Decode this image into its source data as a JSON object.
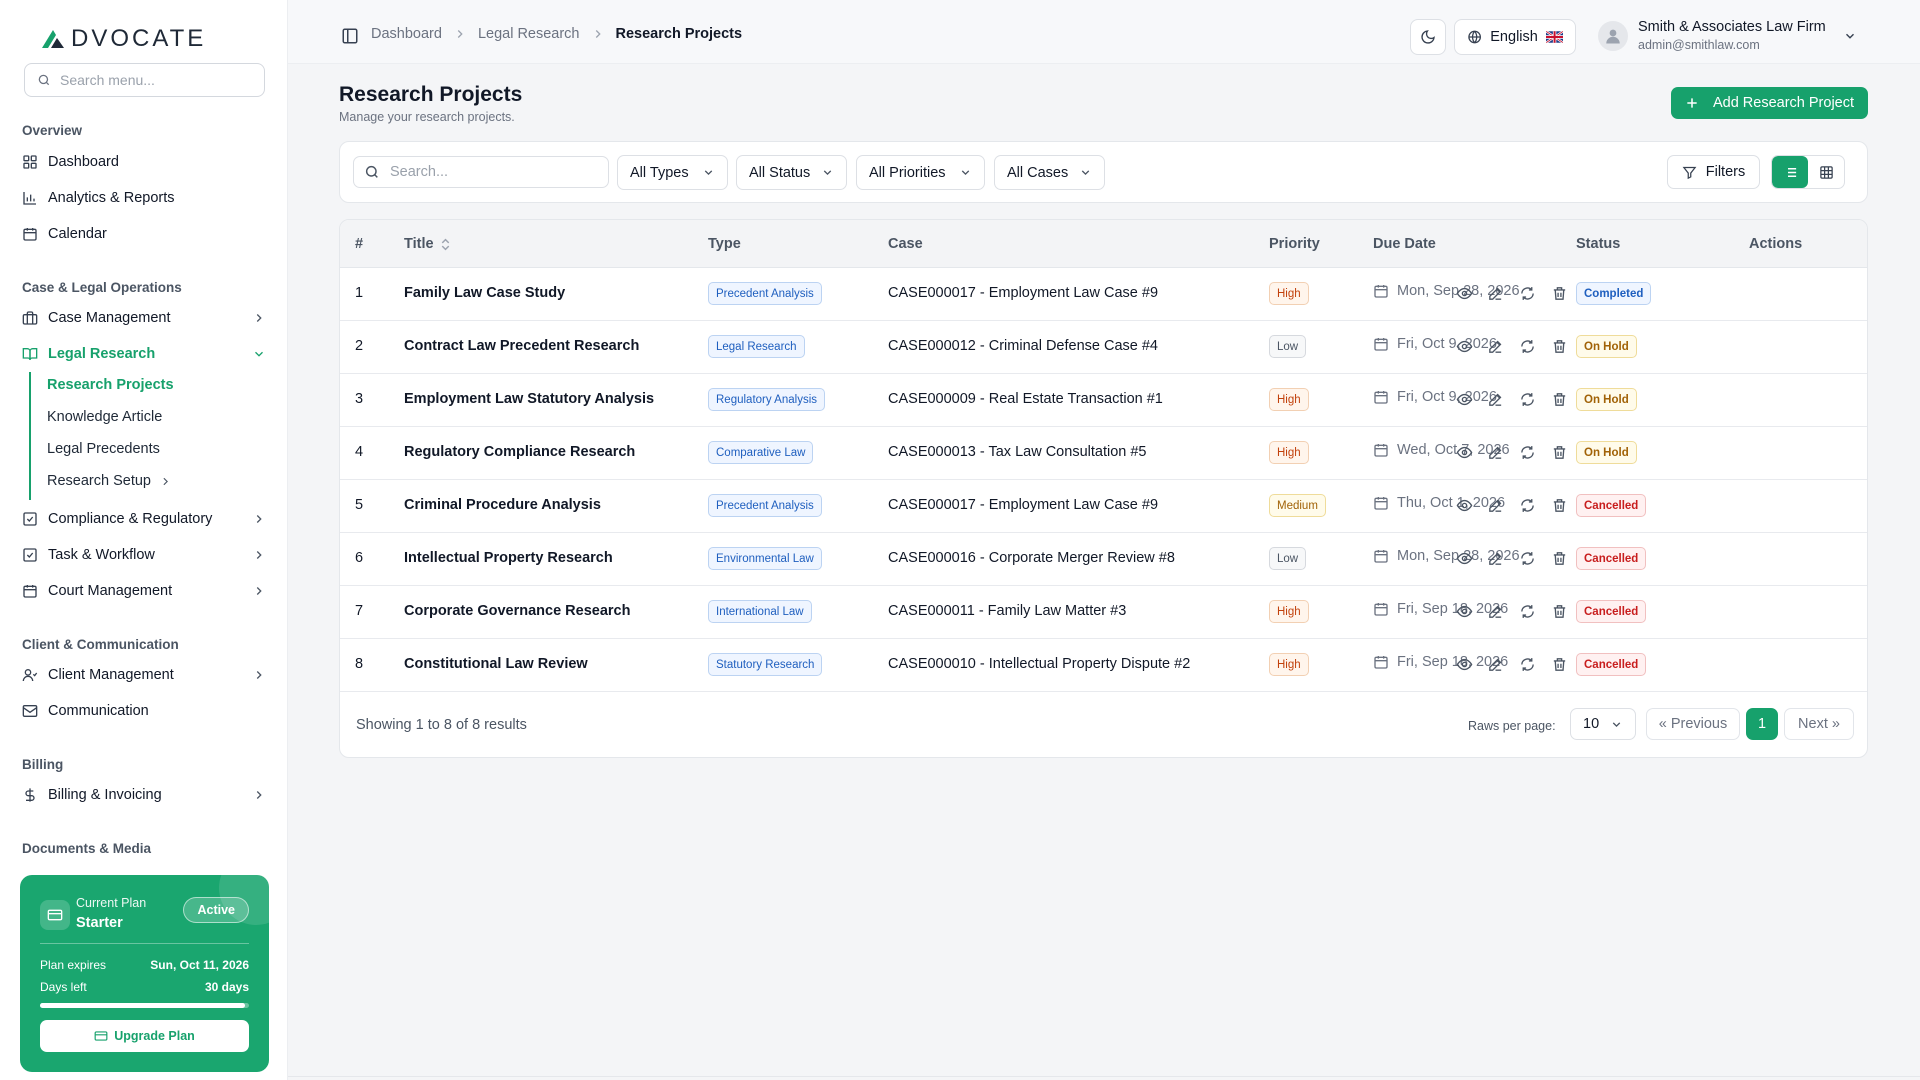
{
  "app": {
    "logo_text": "DVOCATE",
    "brand_color": "#17a16c"
  },
  "sidebar": {
    "search_placeholder": "Search menu...",
    "sections": {
      "overview": "Overview",
      "case_legal": "Case & Legal Operations",
      "client_comm": "Client & Communication",
      "billing": "Billing",
      "documents": "Documents & Media"
    },
    "items": {
      "dashboard": "Dashboard",
      "analytics": "Analytics & Reports",
      "calendar": "Calendar",
      "case_management": "Case Management",
      "legal_research": "Legal Research",
      "compliance": "Compliance & Regulatory",
      "task_workflow": "Task & Workflow",
      "court_management": "Court Management",
      "client_management": "Client Management",
      "communication": "Communication",
      "billing_invoicing": "Billing & Invoicing"
    },
    "sub_items": {
      "research_projects": "Research Projects",
      "knowledge_article": "Knowledge Article",
      "legal_precedents": "Legal Precedents",
      "research_setup": "Research Setup"
    },
    "plan": {
      "label": "Current Plan",
      "name": "Starter",
      "status": "Active",
      "expires_label": "Plan expires",
      "expires_value": "Sun, Oct 11, 2026",
      "days_label": "Days left",
      "days_value": "30 days",
      "progress_percent": 98,
      "upgrade_label": "Upgrade Plan"
    }
  },
  "header": {
    "breadcrumbs": [
      "Dashboard",
      "Legal Research",
      "Research Projects"
    ],
    "language": "English",
    "user": {
      "firm": "Smith & Associates Law Firm",
      "email": "admin@smithlaw.com"
    }
  },
  "page": {
    "title": "Research Projects",
    "subtitle": "Manage your research projects.",
    "add_button": "Add Research Project"
  },
  "filters": {
    "search_placeholder": "Search...",
    "types": "All Types",
    "status": "All Status",
    "priorities": "All Priorities",
    "cases": "All Cases",
    "filters_button": "Filters"
  },
  "table": {
    "columns": {
      "num": "#",
      "title": "Title",
      "type": "Type",
      "case": "Case",
      "priority": "Priority",
      "due_date": "Due Date",
      "status": "Status",
      "actions": "Actions"
    },
    "rows": [
      {
        "num": "1",
        "title": "Family Law Case Study",
        "type": "Precedent Analysis",
        "case": "CASE000017 - Employment Law Case #9",
        "priority": "High",
        "due": "Mon, Sep 28, 2026",
        "status": "Completed"
      },
      {
        "num": "2",
        "title": "Contract Law Precedent Research",
        "type": "Legal Research",
        "case": "CASE000012 - Criminal Defense Case #4",
        "priority": "Low",
        "due": "Fri, Oct 9, 2026",
        "status": "On Hold"
      },
      {
        "num": "3",
        "title": "Employment Law Statutory Analysis",
        "type": "Regulatory Analysis",
        "case": "CASE000009 - Real Estate Transaction #1",
        "priority": "High",
        "due": "Fri, Oct 9, 2026",
        "status": "On Hold"
      },
      {
        "num": "4",
        "title": "Regulatory Compliance Research",
        "type": "Comparative Law",
        "case": "CASE000013 - Tax Law Consultation #5",
        "priority": "High",
        "due": "Wed, Oct 7, 2026",
        "status": "On Hold"
      },
      {
        "num": "5",
        "title": "Criminal Procedure Analysis",
        "type": "Precedent Analysis",
        "case": "CASE000017 - Employment Law Case #9",
        "priority": "Medium",
        "due": "Thu, Oct 1, 2026",
        "status": "Cancelled"
      },
      {
        "num": "6",
        "title": "Intellectual Property Research",
        "type": "Environmental Law",
        "case": "CASE000016 - Corporate Merger Review #8",
        "priority": "Low",
        "due": "Mon, Sep 28, 2026",
        "status": "Cancelled"
      },
      {
        "num": "7",
        "title": "Corporate Governance Research",
        "type": "International Law",
        "case": "CASE000011 - Family Law Matter #3",
        "priority": "High",
        "due": "Fri, Sep 18, 2026",
        "status": "Cancelled"
      },
      {
        "num": "8",
        "title": "Constitutional Law Review",
        "type": "Statutory Research",
        "case": "CASE000010 - Intellectual Property Dispute #2",
        "priority": "High",
        "due": "Fri, Sep 18, 2026",
        "status": "Cancelled"
      }
    ]
  },
  "pagination": {
    "showing": "Showing 1 to 8 of 8 results",
    "rows_per_page_label": "Raws per page:",
    "rows_per_page": "10",
    "previous": "« Previous",
    "current": "1",
    "next": "Next »"
  }
}
